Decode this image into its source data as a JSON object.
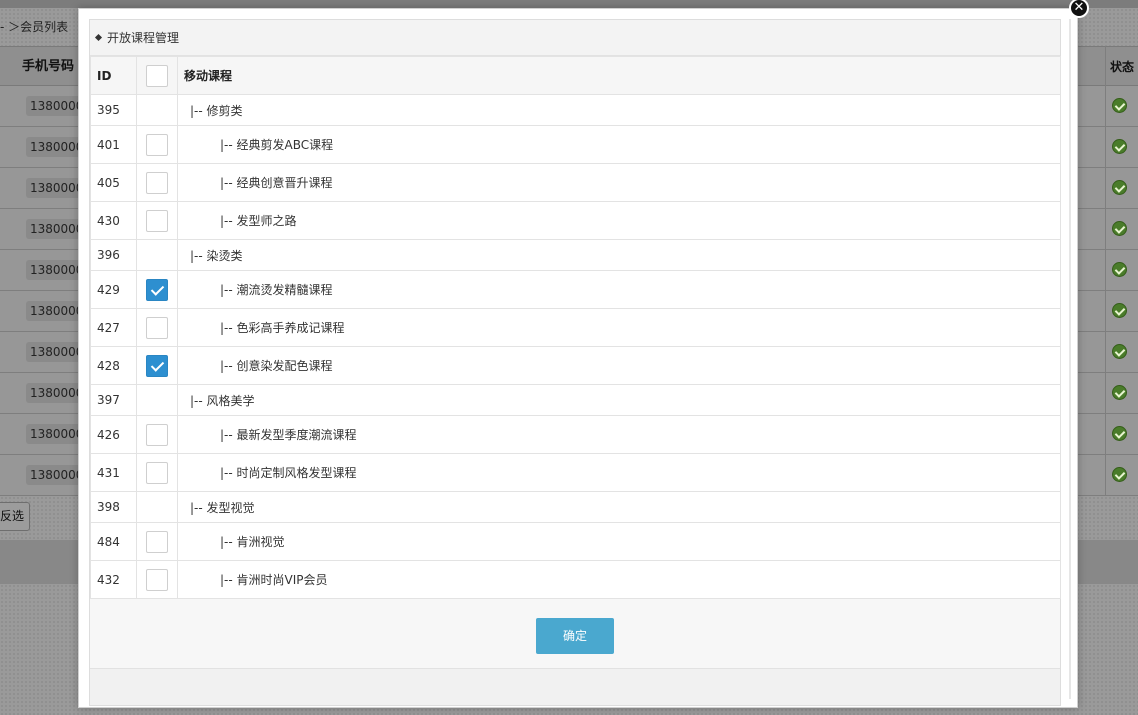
{
  "background": {
    "breadcrumb": "- ＞会员列表",
    "header": {
      "phone_label": "手机号码",
      "status_label": "状态"
    },
    "rows": [
      "1380000",
      "1380000",
      "1380000",
      "1380000",
      "1380000",
      "1380000",
      "1380000",
      "1380000",
      "1380000",
      "1380000"
    ],
    "invert_button": "反选"
  },
  "modal": {
    "close_symbol": "✕",
    "title": "开放课程管理",
    "columns": {
      "id": "ID",
      "name": "移动课程"
    },
    "rows": [
      {
        "id": "395",
        "name": "|-- 修剪类",
        "kind": "cat"
      },
      {
        "id": "401",
        "name": "|-- 经典剪发ABC课程",
        "kind": "item",
        "checked": false
      },
      {
        "id": "405",
        "name": "|-- 经典创意晋升课程",
        "kind": "item",
        "checked": false
      },
      {
        "id": "430",
        "name": "|-- 发型师之路",
        "kind": "item",
        "checked": false
      },
      {
        "id": "396",
        "name": "|-- 染烫类",
        "kind": "cat"
      },
      {
        "id": "429",
        "name": "|-- 潮流烫发精髓课程",
        "kind": "item",
        "checked": true
      },
      {
        "id": "427",
        "name": "|-- 色彩高手养成记课程",
        "kind": "item",
        "checked": false
      },
      {
        "id": "428",
        "name": "|-- 创意染发配色课程",
        "kind": "item",
        "checked": true
      },
      {
        "id": "397",
        "name": "|-- 风格美学",
        "kind": "cat"
      },
      {
        "id": "426",
        "name": "|-- 最新发型季度潮流课程",
        "kind": "item",
        "checked": false
      },
      {
        "id": "431",
        "name": "|-- 时尚定制风格发型课程",
        "kind": "item",
        "checked": false
      },
      {
        "id": "398",
        "name": "|-- 发型视觉",
        "kind": "cat"
      },
      {
        "id": "484",
        "name": "|-- 肯洲视觉",
        "kind": "item",
        "checked": false
      },
      {
        "id": "432",
        "name": "|-- 肯洲时尚VIP会员",
        "kind": "item",
        "checked": false
      }
    ],
    "confirm_label": "确定"
  },
  "colors": {
    "accent": "#4aa8cf",
    "checkbox_checked": "#2d8fd0",
    "status_ok": "#4a7c2a"
  }
}
